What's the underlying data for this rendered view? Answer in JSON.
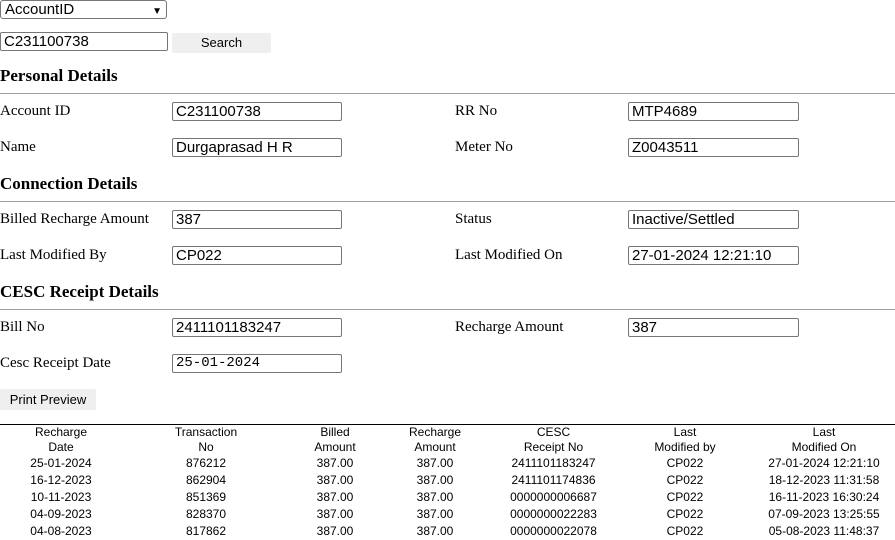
{
  "search": {
    "select_value": "AccountID",
    "input_value": "C231100738",
    "button_label": "Search"
  },
  "personal": {
    "title": "Personal Details",
    "account_id_label": "Account ID",
    "account_id": "C231100738",
    "rr_no_label": "RR No",
    "rr_no": "MTP4689",
    "name_label": "Name",
    "name": "Durgaprasad H R",
    "meter_no_label": "Meter No",
    "meter_no": "Z0043511"
  },
  "connection": {
    "title": "Connection Details",
    "billed_label": "Billed Recharge Amount",
    "billed": "387",
    "status_label": "Status",
    "status": "Inactive/Settled",
    "modified_by_label": "Last Modified By",
    "modified_by": "CP022",
    "modified_on_label": "Last Modified On",
    "modified_on": "27-01-2024 12:21:10"
  },
  "receipt": {
    "title": "CESC Receipt Details",
    "bill_no_label": "Bill No",
    "bill_no": "2411101183247",
    "recharge_label": "Recharge Amount",
    "recharge": "387",
    "date_label": "Cesc Receipt Date",
    "date": "25-01-2024"
  },
  "print_label": "Print Preview",
  "table": {
    "headers": [
      [
        "Recharge",
        "Date"
      ],
      [
        "Transaction",
        "No"
      ],
      [
        "Billed",
        "Amount"
      ],
      [
        "Recharge",
        "Amount"
      ],
      [
        "CESC",
        "Receipt No"
      ],
      [
        "Last",
        "Modified by"
      ],
      [
        "Last",
        "Modified On"
      ]
    ],
    "rows": [
      [
        "25-01-2024",
        "876212",
        "387.00",
        "387.00",
        "2411101183247",
        "CP022",
        "27-01-2024 12:21:10"
      ],
      [
        "16-12-2023",
        "862904",
        "387.00",
        "387.00",
        "2411101174836",
        "CP022",
        "18-12-2023 11:31:58"
      ],
      [
        "10-11-2023",
        "851369",
        "387.00",
        "387.00",
        "0000000006687",
        "CP022",
        "16-11-2023 16:30:24"
      ],
      [
        "04-09-2023",
        "828370",
        "387.00",
        "387.00",
        "0000000022283",
        "CP022",
        "07-09-2023 13:25:55"
      ],
      [
        "04-08-2023",
        "817862",
        "387.00",
        "387.00",
        "0000000022078",
        "CP022",
        "05-08-2023 11:48:37"
      ]
    ]
  }
}
